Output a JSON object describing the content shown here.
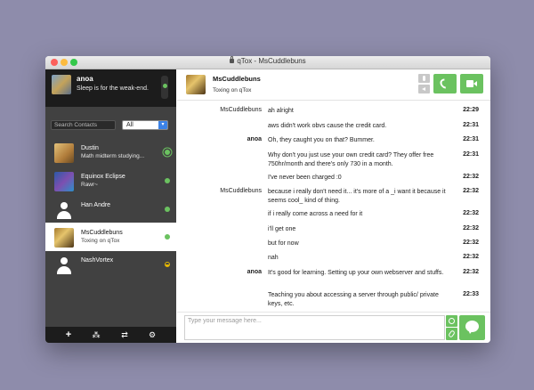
{
  "window": {
    "title": "qTox - MsCuddlebuns"
  },
  "self": {
    "name": "anoa",
    "status_message": "Sleep is for the weak-end."
  },
  "search": {
    "placeholder": "Search Contacts",
    "filter_value": "All"
  },
  "contacts": [
    {
      "name": "Dustin",
      "status": "Math midterm studying..."
    },
    {
      "name": "Equinox Eclipse",
      "status": "Rawr~"
    },
    {
      "name": "Han Andre",
      "status": ""
    },
    {
      "name": "MsCuddlebuns",
      "status": "Toxing on qTox"
    },
    {
      "name": "NashVortex",
      "status": ""
    }
  ],
  "chat": {
    "name": "MsCuddlebuns",
    "status": "Toxing on qTox"
  },
  "messages": [
    {
      "sender": "MsCuddlebuns",
      "text": "ah alright",
      "time": "22:29"
    },
    {
      "sender": "",
      "text": "aws didn't work obvs cause the credit card.",
      "time": "22:31"
    },
    {
      "sender": "anoa",
      "text": "Oh, they caught you on that? Bummer.",
      "time": "22:31"
    },
    {
      "sender": "",
      "text": "Why don't you just use your own credit card? They offer free 750hr/month and there's only 730 in a month.",
      "time": "22:31"
    },
    {
      "sender": "",
      "text": "I've never been charged :0",
      "time": "22:32"
    },
    {
      "sender": "MsCuddlebuns",
      "text": "because i really don't need it... it's more of a _i want it because it seems cool_ kind of thing.",
      "time": "22:32"
    },
    {
      "sender": "",
      "text": "if i really come across a need for it",
      "time": "22:32"
    },
    {
      "sender": "",
      "text": "i'll get one",
      "time": "22:32"
    },
    {
      "sender": "",
      "text": "but for now",
      "time": "22:32"
    },
    {
      "sender": "",
      "text": "nah",
      "time": "22:32"
    },
    {
      "sender": "anoa",
      "text": "It's good for learning. Setting up your own webserver and stuffs.",
      "time": "22:32"
    },
    {
      "sender": "",
      "text": "Teaching you about accessing a server through public/ private keys, etc.",
      "time": "22:33"
    }
  ],
  "input": {
    "placeholder": "Type your message here..."
  },
  "icons": {
    "add": "plus-icon",
    "groups": "group-icon",
    "transfers": "transfer-icon",
    "settings": "gear-icon",
    "call": "phone-icon",
    "video": "camera-icon",
    "send": "speech-bubble-icon"
  },
  "colors": {
    "accent": "#6bc260",
    "sidebar": "#414141",
    "sidebar_dark": "#1c1c1c",
    "filter_arrow": "#3b82e6"
  }
}
